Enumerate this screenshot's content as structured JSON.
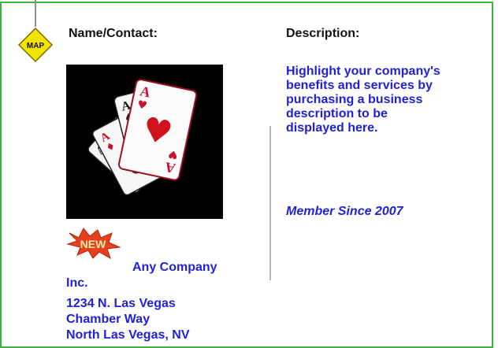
{
  "header": {
    "name_contact_label": "Name/Contact:",
    "description_label": "Description:"
  },
  "map_pin": {
    "label": "MAP",
    "icon": "map-pin-icon",
    "color": "#f2e400"
  },
  "listing": {
    "image_icon": "playing-cards-aces-icon",
    "badge_label": "NEW",
    "badge_color": "#e8401c",
    "company_name_line1": "Any Company",
    "company_name_line2": "Inc.",
    "address_line1": "1234 N. Las Vegas",
    "address_line2": "Chamber Way",
    "address_line3": "North Las Vegas, NV",
    "text_color": "#1f1fdc"
  },
  "description": {
    "lines": [
      "Highlight your company's",
      "benefits and services by",
      "purchasing a business",
      "description to be",
      "displayed here."
    ],
    "member_since": "Member Since 2007"
  },
  "frame_color": "#3cb33c"
}
